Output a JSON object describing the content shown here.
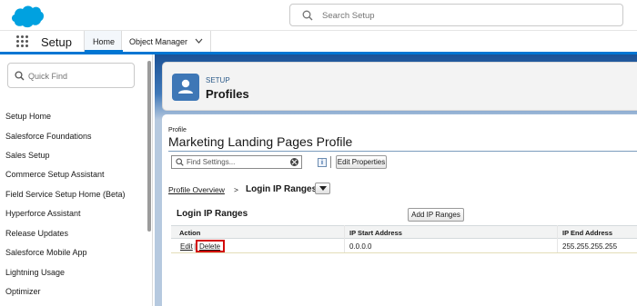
{
  "header": {
    "search_placeholder": "Search Setup"
  },
  "nav": {
    "app_name": "Setup",
    "tabs": [
      {
        "label": "Home"
      },
      {
        "label": "Object Manager"
      }
    ]
  },
  "sidebar": {
    "quick_find_placeholder": "Quick Find",
    "items": [
      {
        "label": "Setup Home"
      },
      {
        "label": "Salesforce Foundations"
      },
      {
        "label": "Sales Setup"
      },
      {
        "label": "Commerce Setup Assistant"
      },
      {
        "label": "Field Service Setup Home (Beta)"
      },
      {
        "label": "Hyperforce Assistant"
      },
      {
        "label": "Release Updates"
      },
      {
        "label": "Salesforce Mobile App"
      },
      {
        "label": "Lightning Usage"
      },
      {
        "label": "Optimizer"
      }
    ]
  },
  "page_header": {
    "eyebrow": "SETUP",
    "title": "Profiles"
  },
  "content": {
    "label": "Profile",
    "profile_name": "Marketing Landing Pages Profile",
    "find_placeholder": "Find Settings...",
    "info_label": "i",
    "edit_properties_label": "Edit Properties",
    "breadcrumb_link": "Profile Overview",
    "breadcrumb_sep": ">",
    "breadcrumb_current": "Login IP Ranges",
    "section_title": "Login IP Ranges",
    "add_button_label": "Add IP Ranges",
    "table": {
      "headers": [
        "Action",
        "IP Start Address",
        "IP End Address"
      ],
      "rows": [
        {
          "edit": "Edit",
          "sep": "|",
          "delete": "Delete",
          "start": "0.0.0.0",
          "end": "255.255.255.255"
        }
      ]
    }
  },
  "colors": {
    "brand_blue": "#0176d3",
    "highlight_red": "#d20a0a",
    "logo_blue": "#00a1e0"
  }
}
